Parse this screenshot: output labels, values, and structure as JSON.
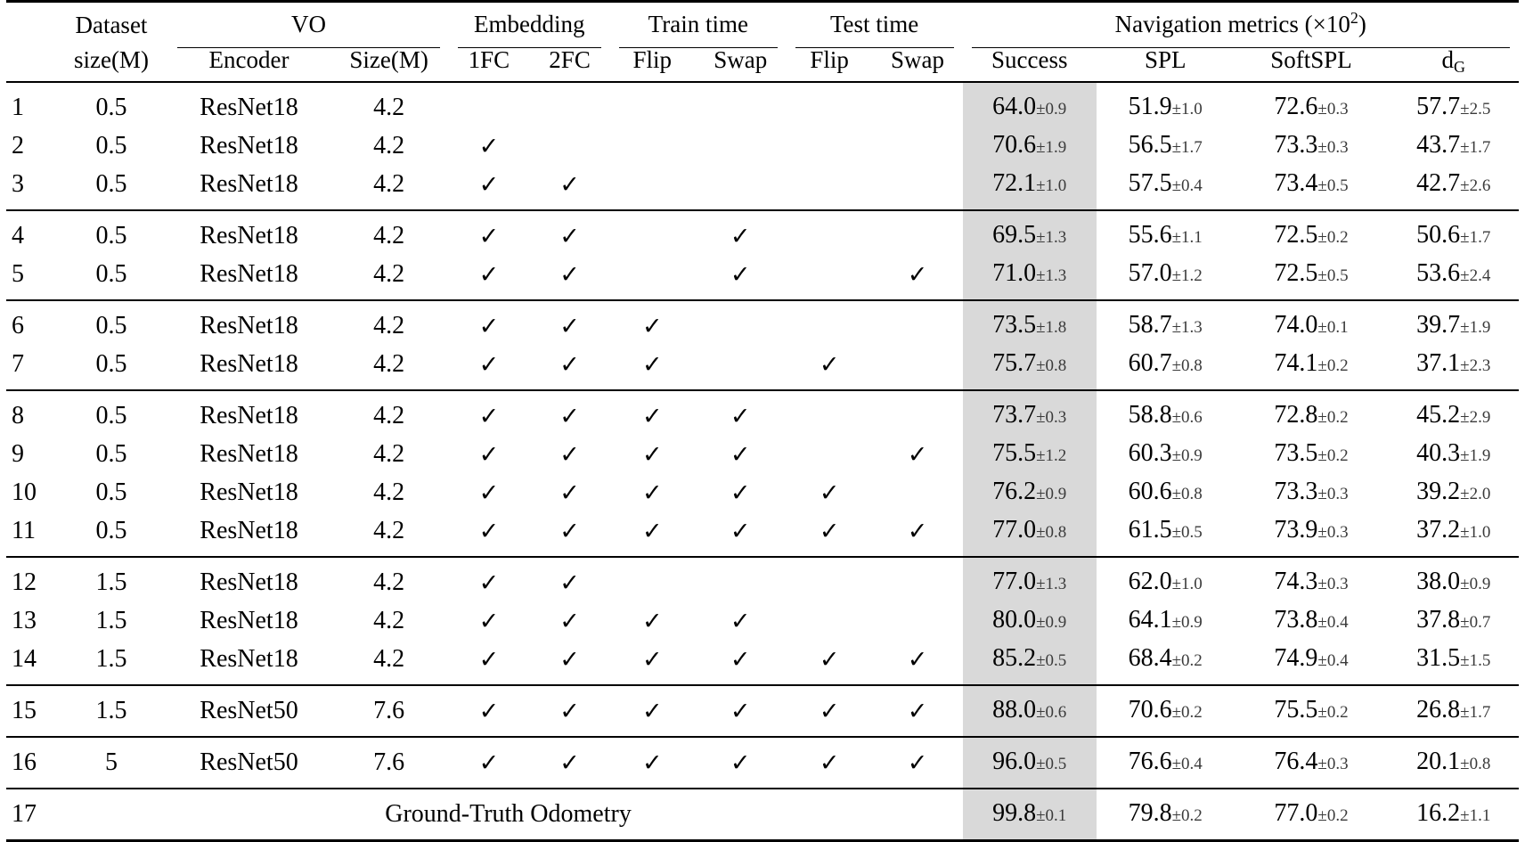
{
  "table": {
    "headers": {
      "group_dataset": "Dataset",
      "group_vo": "VO",
      "group_embedding": "Embedding",
      "group_train_time": "Train time",
      "group_test_time": "Test time",
      "group_nav_metrics_pre": "Navigation metrics (×10",
      "group_nav_metrics_exp": "2",
      "group_nav_metrics_post": ")",
      "sub_dataset_size": "size(M)",
      "sub_encoder": "Encoder",
      "sub_vo_size": "Size(M)",
      "sub_1fc": "1FC",
      "sub_2fc": "2FC",
      "sub_train_flip": "Flip",
      "sub_train_swap": "Swap",
      "sub_test_flip": "Flip",
      "sub_test_swap": "Swap",
      "sub_success": "Success",
      "sub_spl": "SPL",
      "sub_softspl": "SoftSPL",
      "sub_dg_base": "d",
      "sub_dg_sub": "G"
    },
    "check_glyph": "✓",
    "ground_truth_label": "Ground-Truth Odometry",
    "rows": [
      {
        "idx": "1",
        "dsize": "0.5",
        "encoder": "ResNet18",
        "vosize": "4.2",
        "fc1": "",
        "fc2": "",
        "trflip": "",
        "trswap": "",
        "teflip": "",
        "teswap": "",
        "success": "64.0",
        "success_pm": "±0.9",
        "spl": "51.9",
        "spl_pm": "±1.0",
        "softspl": "72.6",
        "softspl_pm": "±0.3",
        "dg": "57.7",
        "dg_pm": "±2.5"
      },
      {
        "idx": "2",
        "dsize": "0.5",
        "encoder": "ResNet18",
        "vosize": "4.2",
        "fc1": "✓",
        "fc2": "",
        "trflip": "",
        "trswap": "",
        "teflip": "",
        "teswap": "",
        "success": "70.6",
        "success_pm": "±1.9",
        "spl": "56.5",
        "spl_pm": "±1.7",
        "softspl": "73.3",
        "softspl_pm": "±0.3",
        "dg": "43.7",
        "dg_pm": "±1.7"
      },
      {
        "idx": "3",
        "dsize": "0.5",
        "encoder": "ResNet18",
        "vosize": "4.2",
        "fc1": "✓",
        "fc2": "✓",
        "trflip": "",
        "trswap": "",
        "teflip": "",
        "teswap": "",
        "success": "72.1",
        "success_pm": "±1.0",
        "spl": "57.5",
        "spl_pm": "±0.4",
        "softspl": "73.4",
        "softspl_pm": "±0.5",
        "dg": "42.7",
        "dg_pm": "±2.6"
      },
      {
        "idx": "4",
        "dsize": "0.5",
        "encoder": "ResNet18",
        "vosize": "4.2",
        "fc1": "✓",
        "fc2": "✓",
        "trflip": "",
        "trswap": "✓",
        "teflip": "",
        "teswap": "",
        "success": "69.5",
        "success_pm": "±1.3",
        "spl": "55.6",
        "spl_pm": "±1.1",
        "softspl": "72.5",
        "softspl_pm": "±0.2",
        "dg": "50.6",
        "dg_pm": "±1.7"
      },
      {
        "idx": "5",
        "dsize": "0.5",
        "encoder": "ResNet18",
        "vosize": "4.2",
        "fc1": "✓",
        "fc2": "✓",
        "trflip": "",
        "trswap": "✓",
        "teflip": "",
        "teswap": "✓",
        "success": "71.0",
        "success_pm": "±1.3",
        "spl": "57.0",
        "spl_pm": "±1.2",
        "softspl": "72.5",
        "softspl_pm": "±0.5",
        "dg": "53.6",
        "dg_pm": "±2.4"
      },
      {
        "idx": "6",
        "dsize": "0.5",
        "encoder": "ResNet18",
        "vosize": "4.2",
        "fc1": "✓",
        "fc2": "✓",
        "trflip": "✓",
        "trswap": "",
        "teflip": "",
        "teswap": "",
        "success": "73.5",
        "success_pm": "±1.8",
        "spl": "58.7",
        "spl_pm": "±1.3",
        "softspl": "74.0",
        "softspl_pm": "±0.1",
        "dg": "39.7",
        "dg_pm": "±1.9"
      },
      {
        "idx": "7",
        "dsize": "0.5",
        "encoder": "ResNet18",
        "vosize": "4.2",
        "fc1": "✓",
        "fc2": "✓",
        "trflip": "✓",
        "trswap": "",
        "teflip": "✓",
        "teswap": "",
        "success": "75.7",
        "success_pm": "±0.8",
        "spl": "60.7",
        "spl_pm": "±0.8",
        "softspl": "74.1",
        "softspl_pm": "±0.2",
        "dg": "37.1",
        "dg_pm": "±2.3"
      },
      {
        "idx": "8",
        "dsize": "0.5",
        "encoder": "ResNet18",
        "vosize": "4.2",
        "fc1": "✓",
        "fc2": "✓",
        "trflip": "✓",
        "trswap": "✓",
        "teflip": "",
        "teswap": "",
        "success": "73.7",
        "success_pm": "±0.3",
        "spl": "58.8",
        "spl_pm": "±0.6",
        "softspl": "72.8",
        "softspl_pm": "±0.2",
        "dg": "45.2",
        "dg_pm": "±2.9"
      },
      {
        "idx": "9",
        "dsize": "0.5",
        "encoder": "ResNet18",
        "vosize": "4.2",
        "fc1": "✓",
        "fc2": "✓",
        "trflip": "✓",
        "trswap": "✓",
        "teflip": "",
        "teswap": "✓",
        "success": "75.5",
        "success_pm": "±1.2",
        "spl": "60.3",
        "spl_pm": "±0.9",
        "softspl": "73.5",
        "softspl_pm": "±0.2",
        "dg": "40.3",
        "dg_pm": "±1.9"
      },
      {
        "idx": "10",
        "dsize": "0.5",
        "encoder": "ResNet18",
        "vosize": "4.2",
        "fc1": "✓",
        "fc2": "✓",
        "trflip": "✓",
        "trswap": "✓",
        "teflip": "✓",
        "teswap": "",
        "success": "76.2",
        "success_pm": "±0.9",
        "spl": "60.6",
        "spl_pm": "±0.8",
        "softspl": "73.3",
        "softspl_pm": "±0.3",
        "dg": "39.2",
        "dg_pm": "±2.0"
      },
      {
        "idx": "11",
        "dsize": "0.5",
        "encoder": "ResNet18",
        "vosize": "4.2",
        "fc1": "✓",
        "fc2": "✓",
        "trflip": "✓",
        "trswap": "✓",
        "teflip": "✓",
        "teswap": "✓",
        "success": "77.0",
        "success_pm": "±0.8",
        "spl": "61.5",
        "spl_pm": "±0.5",
        "softspl": "73.9",
        "softspl_pm": "±0.3",
        "dg": "37.2",
        "dg_pm": "±1.0"
      },
      {
        "idx": "12",
        "dsize": "1.5",
        "encoder": "ResNet18",
        "vosize": "4.2",
        "fc1": "✓",
        "fc2": "✓",
        "trflip": "",
        "trswap": "",
        "teflip": "",
        "teswap": "",
        "success": "77.0",
        "success_pm": "±1.3",
        "spl": "62.0",
        "spl_pm": "±1.0",
        "softspl": "74.3",
        "softspl_pm": "±0.3",
        "dg": "38.0",
        "dg_pm": "±0.9"
      },
      {
        "idx": "13",
        "dsize": "1.5",
        "encoder": "ResNet18",
        "vosize": "4.2",
        "fc1": "✓",
        "fc2": "✓",
        "trflip": "✓",
        "trswap": "✓",
        "teflip": "",
        "teswap": "",
        "success": "80.0",
        "success_pm": "±0.9",
        "spl": "64.1",
        "spl_pm": "±0.9",
        "softspl": "73.8",
        "softspl_pm": "±0.4",
        "dg": "37.8",
        "dg_pm": "±0.7"
      },
      {
        "idx": "14",
        "dsize": "1.5",
        "encoder": "ResNet18",
        "vosize": "4.2",
        "fc1": "✓",
        "fc2": "✓",
        "trflip": "✓",
        "trswap": "✓",
        "teflip": "✓",
        "teswap": "✓",
        "success": "85.2",
        "success_pm": "±0.5",
        "spl": "68.4",
        "spl_pm": "±0.2",
        "softspl": "74.9",
        "softspl_pm": "±0.4",
        "dg": "31.5",
        "dg_pm": "±1.5"
      },
      {
        "idx": "15",
        "dsize": "1.5",
        "encoder": "ResNet50",
        "vosize": "7.6",
        "fc1": "✓",
        "fc2": "✓",
        "trflip": "✓",
        "trswap": "✓",
        "teflip": "✓",
        "teswap": "✓",
        "success": "88.0",
        "success_pm": "±0.6",
        "spl": "70.6",
        "spl_pm": "±0.2",
        "softspl": "75.5",
        "softspl_pm": "±0.2",
        "dg": "26.8",
        "dg_pm": "±1.7"
      },
      {
        "idx": "16",
        "dsize": "5",
        "encoder": "ResNet50",
        "vosize": "7.6",
        "fc1": "✓",
        "fc2": "✓",
        "trflip": "✓",
        "trswap": "✓",
        "teflip": "✓",
        "teswap": "✓",
        "success": "96.0",
        "success_pm": "±0.5",
        "spl": "76.6",
        "spl_pm": "±0.4",
        "softspl": "76.4",
        "softspl_pm": "±0.3",
        "dg": "20.1",
        "dg_pm": "±0.8"
      },
      {
        "idx": "17",
        "dsize": "",
        "encoder": "",
        "vosize": "",
        "fc1": "",
        "fc2": "",
        "trflip": "",
        "trswap": "",
        "teflip": "",
        "teswap": "",
        "success": "99.8",
        "success_pm": "±0.1",
        "spl": "79.8",
        "spl_pm": "±0.2",
        "softspl": "77.0",
        "softspl_pm": "±0.2",
        "dg": "16.2",
        "dg_pm": "±1.1"
      }
    ]
  },
  "style": {
    "highlight_color": "#d9d9d9",
    "text_color": "#000000",
    "pm_color": "#3a3a3a"
  }
}
